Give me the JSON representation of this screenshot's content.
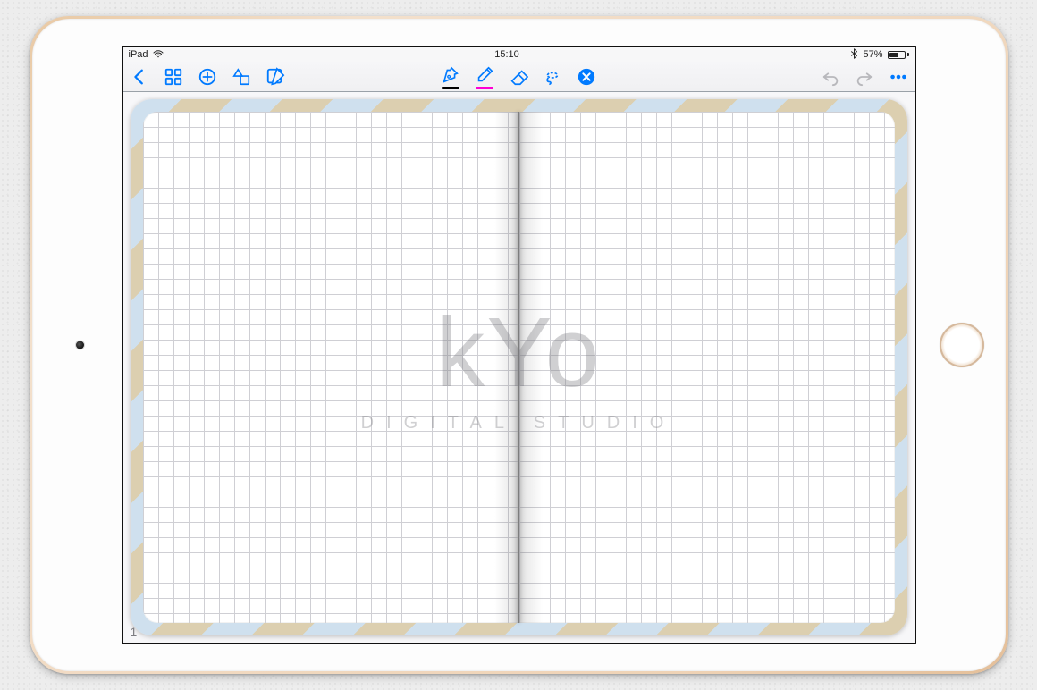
{
  "status": {
    "device": "iPad",
    "time": "15:10",
    "battery": "57%",
    "bluetooth_icon": "bluetooth",
    "wifi_icon": "wifi"
  },
  "toolbar": {
    "back": "Back",
    "thumbnails": "Thumbnails",
    "add": "Add",
    "shapes": "Shapes",
    "edit": "Edit",
    "pen": "Pen",
    "highlighter": "Highlighter",
    "eraser": "Eraser",
    "lasso": "Lasso",
    "close_tool": "Close",
    "undo": "Undo",
    "redo": "Redo",
    "more": "More"
  },
  "document": {
    "page_number": "1"
  },
  "watermark": {
    "main": "kYo",
    "sub": "DIGITAL STUDIO"
  }
}
